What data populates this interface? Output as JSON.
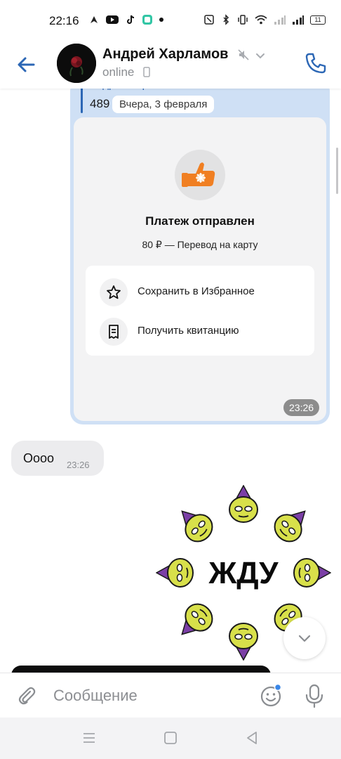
{
  "status_bar": {
    "time": "22:16",
    "battery": "11",
    "left_icons": [
      "navigation-icon",
      "youtube-icon",
      "tiktok-icon",
      "app-icon",
      "dot-icon"
    ],
    "right_icons": [
      "nfc-icon",
      "bluetooth-icon",
      "vibrate-icon",
      "wifi-icon",
      "signal-icon",
      "signal-icon"
    ]
  },
  "header": {
    "contact_name": "Андрей Харламов",
    "status": "online",
    "accent_color": "#2c67b5"
  },
  "payment_message": {
    "reply_author": "Андрей Харламов",
    "reply_text": "489",
    "date_chip": "Вчера, 3 февраля",
    "title": "Платеж отправлен",
    "subtitle": "80 ₽ — Перевод на карту",
    "actions": [
      {
        "label": "Сохранить в Избранное",
        "icon": "star-icon"
      },
      {
        "label": "Получить квитанцию",
        "icon": "receipt-icon"
      }
    ],
    "time": "23:26",
    "bubble_color": "#cfe0f5"
  },
  "incoming_message": {
    "text": "Оооо",
    "time": "23:26"
  },
  "sticker": {
    "text": "ЖДУ"
  },
  "composer": {
    "placeholder": "Сообщение"
  }
}
